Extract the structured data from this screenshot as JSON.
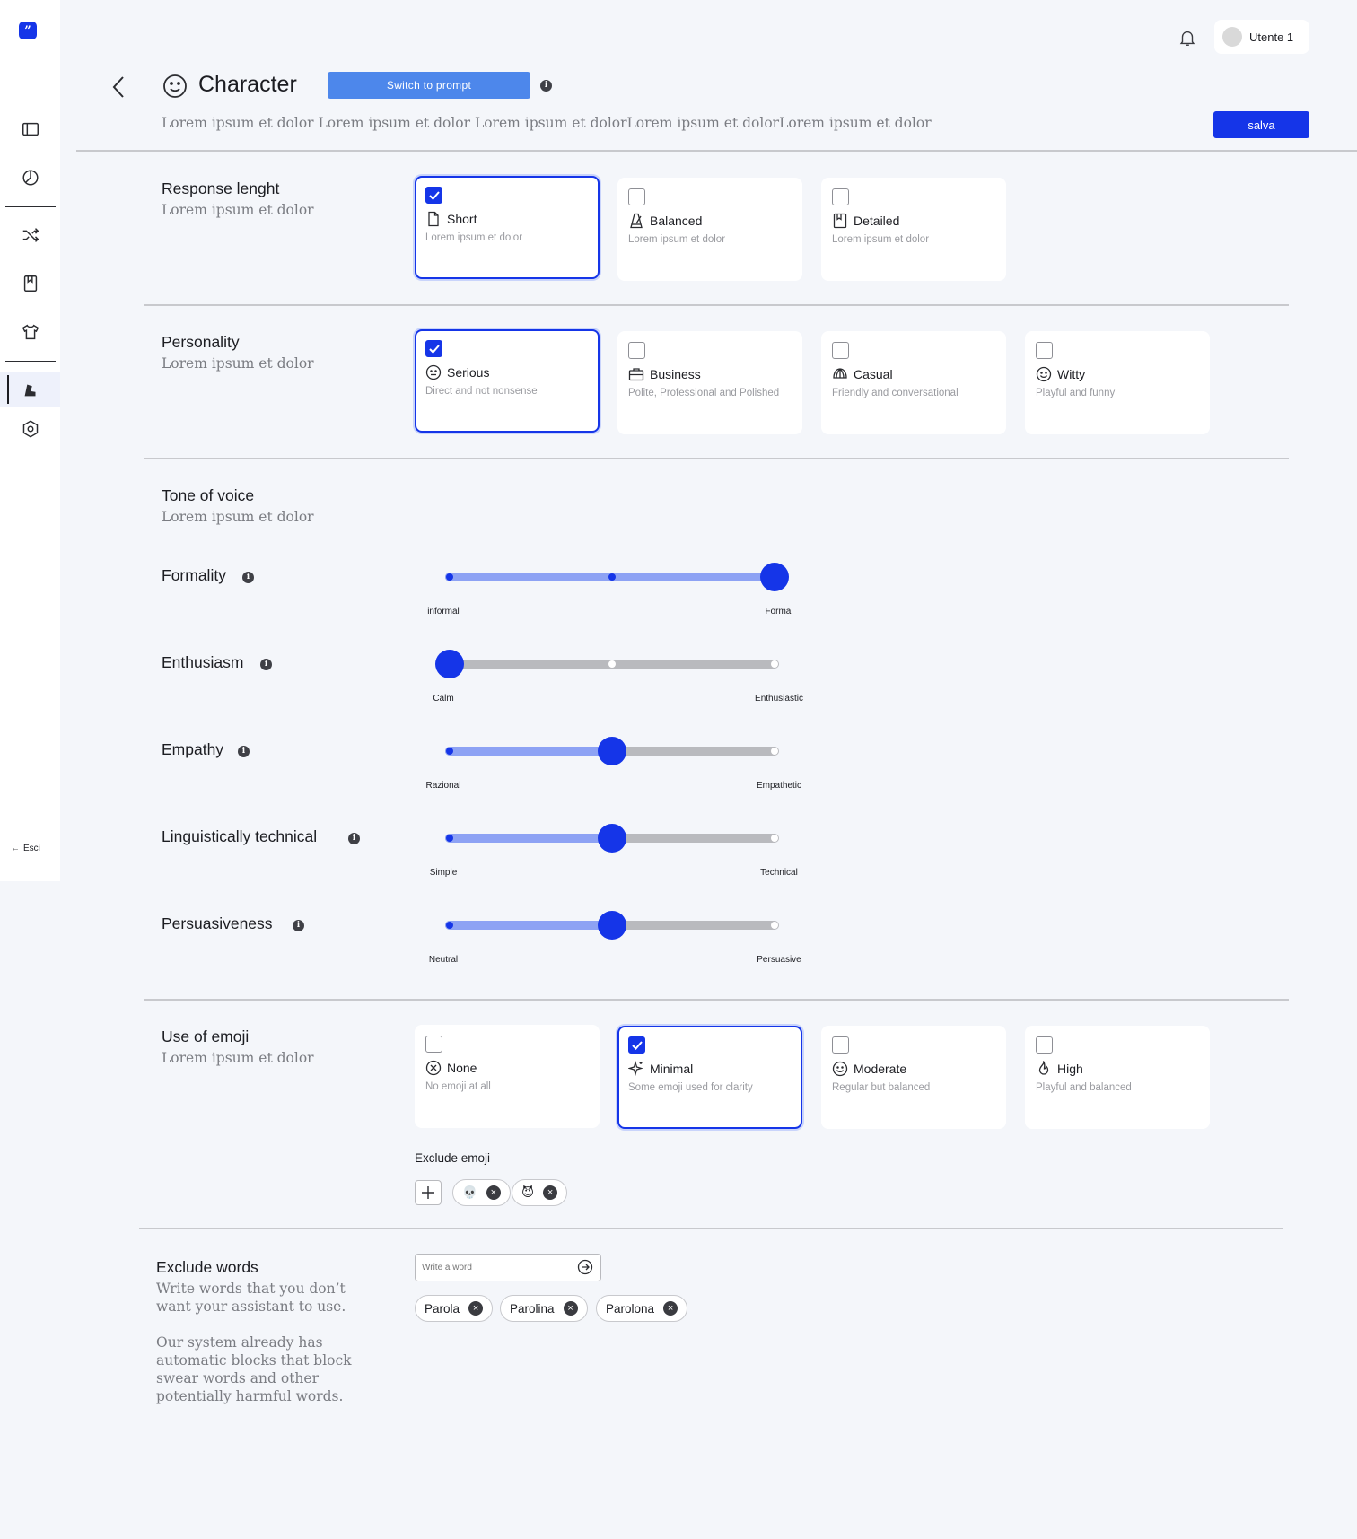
{
  "sidebar": {
    "logo": "”",
    "exit_label": "Esci"
  },
  "header": {
    "user_name": "Utente 1",
    "title": "Character",
    "switch_label": "Switch to prompt",
    "info_glyph": "i",
    "subtitle": "Lorem ipsum et dolor Lorem ipsum et dolor Lorem ipsum et dolorLorem ipsum et dolorLorem ipsum et dolor",
    "save_label": "salva"
  },
  "response_length": {
    "title": "Response lenght",
    "subtitle": "Lorem ipsum et dolor",
    "options": [
      {
        "label": "Short",
        "desc": "Lorem ipsum et dolor",
        "selected": true,
        "icon": "file-icon"
      },
      {
        "label": "Balanced",
        "desc": "Lorem ipsum et dolor",
        "selected": false,
        "icon": "metronome-icon"
      },
      {
        "label": "Detailed",
        "desc": "Lorem ipsum et dolor",
        "selected": false,
        "icon": "book-icon"
      }
    ]
  },
  "personality": {
    "title": "Personality",
    "subtitle": "Lorem ipsum et dolor",
    "options": [
      {
        "label": "Serious",
        "desc": "Direct and not nonsense",
        "selected": true,
        "icon": "neutral-face-icon"
      },
      {
        "label": "Business",
        "desc": "Polite, Professional and Polished",
        "selected": false,
        "icon": "briefcase-icon"
      },
      {
        "label": "Casual",
        "desc": "Friendly and conversational",
        "selected": false,
        "icon": "cap-icon"
      },
      {
        "label": "Witty",
        "desc": "Playful and funny",
        "selected": false,
        "icon": "smile-icon"
      }
    ]
  },
  "tone": {
    "title": "Tone of voice",
    "subtitle": "Lorem ipsum et dolor",
    "sliders": [
      {
        "label": "Formality",
        "min": "informal",
        "max": "Formal",
        "value": 1.0
      },
      {
        "label": "Enthusiasm",
        "min": "Calm",
        "max": "Enthusiastic",
        "value": 0.0
      },
      {
        "label": "Empathy",
        "min": "Razional",
        "max": "Empathetic",
        "value": 0.5
      },
      {
        "label": "Linguistically technical",
        "min": "Simple",
        "max": "Technical",
        "value": 0.5
      },
      {
        "label": "Persuasiveness",
        "min": "Neutral",
        "max": "Persuasive",
        "value": 0.5
      }
    ]
  },
  "emoji": {
    "title": "Use of emoji",
    "subtitle": "Lorem ipsum et dolor",
    "options": [
      {
        "label": "None",
        "desc": "No emoji at all",
        "selected": false,
        "icon": "x-circle-icon"
      },
      {
        "label": "Minimal",
        "desc": "Some emoji used for clarity",
        "selected": true,
        "icon": "sparkle-icon"
      },
      {
        "label": "Moderate",
        "desc": "Regular but balanced",
        "selected": false,
        "icon": "smile-icon"
      },
      {
        "label": "High",
        "desc": "Playful and balanced",
        "selected": false,
        "icon": "flame-icon"
      }
    ],
    "exclude_label": "Exclude emoji",
    "excluded": [
      "💀",
      "😈"
    ]
  },
  "exclude_words": {
    "title": "Exclude words",
    "subtitle": "Write words that you don’t want your assistant to use.",
    "note": "Our system already has automatic blocks that block swear words and other potentially harmful words.",
    "placeholder": "Write a word",
    "words": [
      "Parola",
      "Parolina",
      "Parolona"
    ]
  },
  "colors": {
    "accent": "#1535e8",
    "track_fill": "#8da2f4",
    "track": "#b9babe",
    "switch": "#4d87eb"
  }
}
